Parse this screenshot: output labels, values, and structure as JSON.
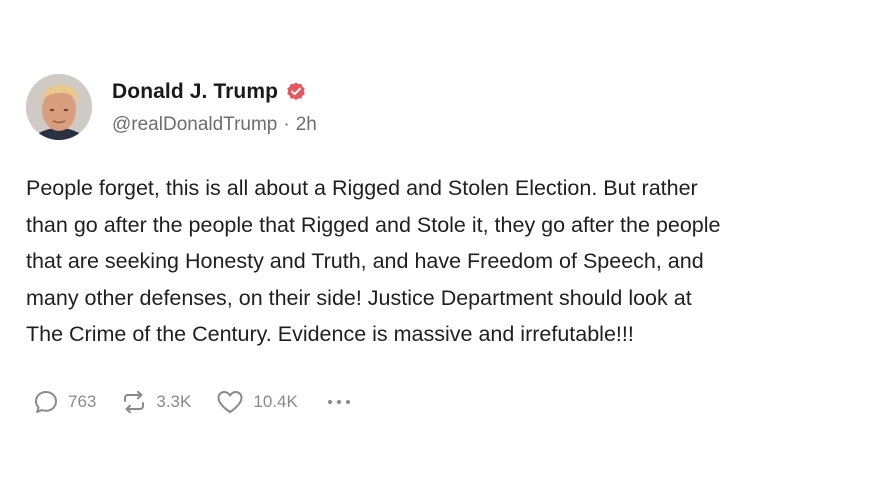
{
  "author": {
    "display_name": "Donald J. Trump",
    "handle": "@realDonaldTrump",
    "separator": "·",
    "time_ago": "2h"
  },
  "post": {
    "text": "People forget, this is all about a Rigged and Stolen Election. But rather\nthan go after the people that Rigged and Stole it, they go after the people\nthat are seeking Honesty and Truth, and have Freedom of Speech, and\nmany other defenses, on their side! Justice Department should look at\nThe Crime of the Century. Evidence is massive and irrefutable!!!"
  },
  "actions": {
    "replies": "763",
    "reposts": "3.3K",
    "likes": "10.4K"
  },
  "icons": {
    "verified": "verified-badge-icon",
    "reply": "reply-bubble-icon",
    "repost": "repost-arrows-icon",
    "like": "heart-icon",
    "more": "more-dots-icon"
  },
  "colors": {
    "verified_badge": "#e8565f",
    "muted_text": "#8a8a8a"
  }
}
